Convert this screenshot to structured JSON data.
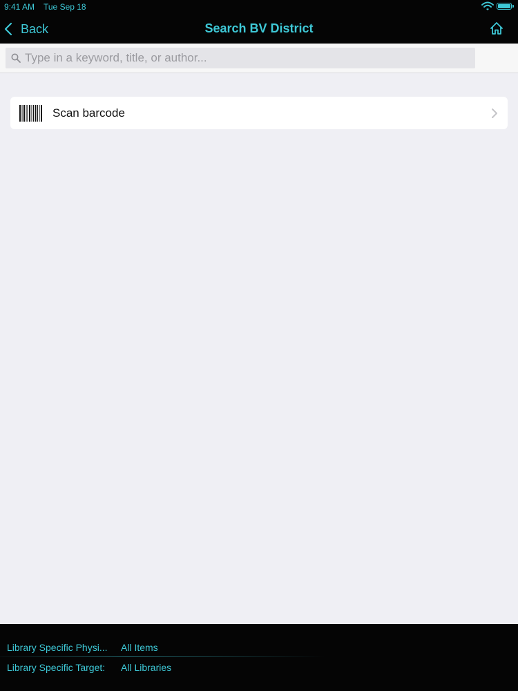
{
  "status_bar": {
    "time": "9:41 AM",
    "date": "Tue Sep 18",
    "battery_level": 1.0
  },
  "nav": {
    "back_label": "Back",
    "title": "Search BV District",
    "home_icon": "home-icon"
  },
  "search": {
    "placeholder": "Type in a keyword, title, or author...",
    "value": ""
  },
  "list": {
    "items": [
      {
        "label": "Scan barcode",
        "icon": "barcode-icon"
      }
    ]
  },
  "footer": {
    "filters": [
      {
        "label": "Library Specific Physi...",
        "value": "All Items"
      },
      {
        "label": "Library Specific Target:",
        "value": "All Libraries"
      }
    ]
  },
  "colors": {
    "accent": "#3ec8d6",
    "bar_background": "#050505",
    "page_background": "#efeff4"
  }
}
